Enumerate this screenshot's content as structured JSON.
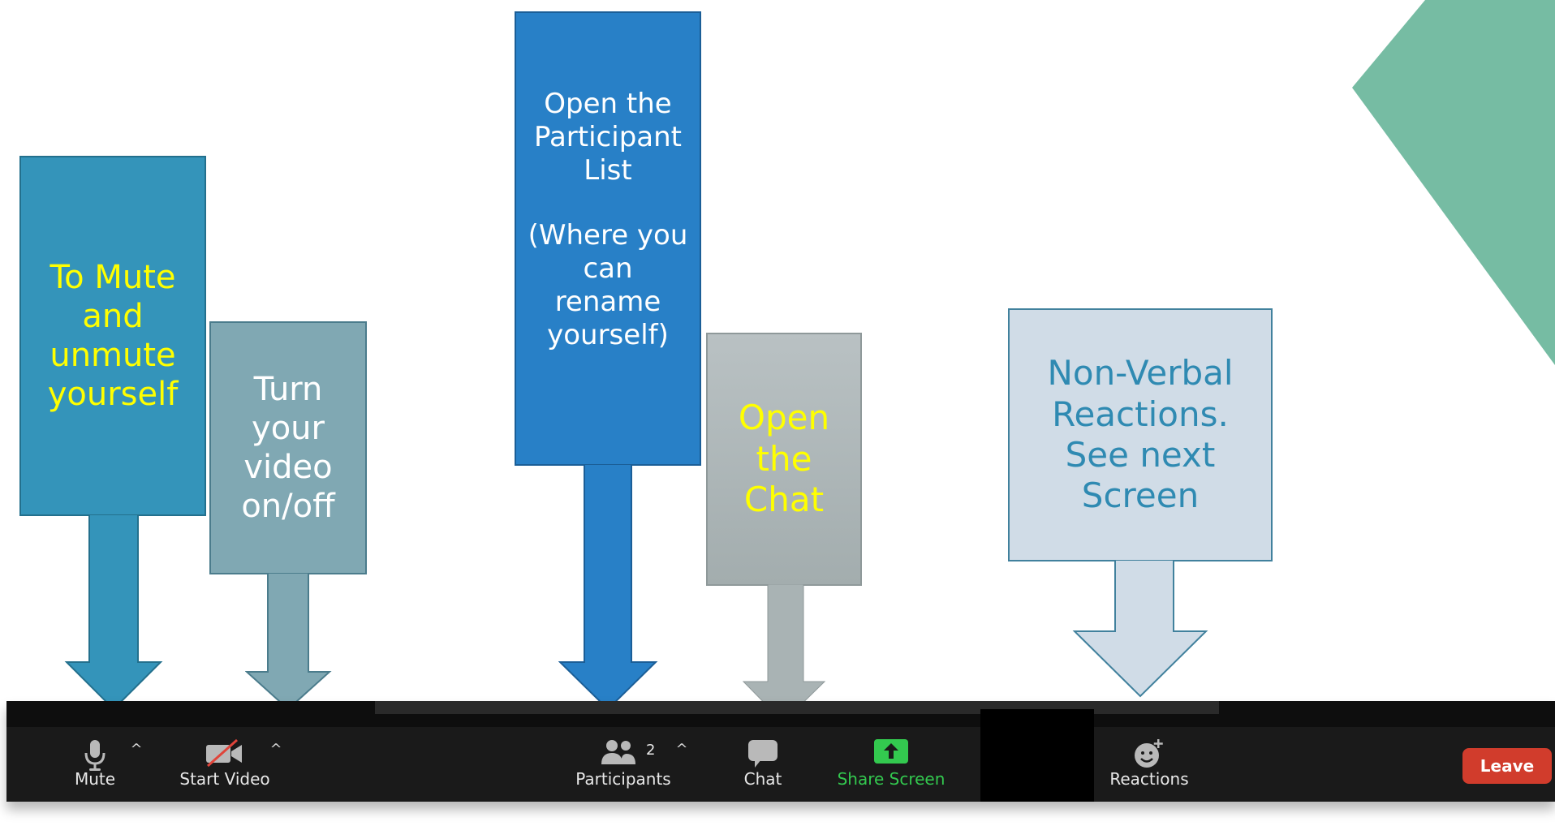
{
  "colors": {
    "accent_green": "#76bca3",
    "mute_callout": "#3494ba",
    "video_callout": "#80a8b3",
    "participants_callout": "#2880c7",
    "chat_callout": "#a9b3b4",
    "reactions_callout": "#d0dce7",
    "toolbar_bg": "#1a1a1a",
    "share_green": "#33c94f",
    "leave_red": "#d13c2c",
    "highlight_yellow": "#ffff00"
  },
  "callouts": {
    "mute": {
      "lines": [
        "To Mute",
        "and",
        "unmute",
        "yourself"
      ]
    },
    "video": {
      "lines": [
        "Turn",
        "your",
        "video",
        "on/off"
      ]
    },
    "participants": {
      "lines": [
        "Open the",
        "Participant",
        "List",
        "",
        "(Where you",
        "can",
        "rename",
        "yourself)"
      ]
    },
    "chat": {
      "lines": [
        "Open",
        "the",
        "Chat"
      ]
    },
    "reactions": {
      "lines": [
        "Non-Verbal",
        "Reactions.",
        "See next",
        "Screen"
      ]
    }
  },
  "toolbar": {
    "mute": {
      "label": "Mute",
      "icon": "microphone-icon"
    },
    "video": {
      "label": "Start Video",
      "icon": "video-off-icon"
    },
    "participants": {
      "label": "Participants",
      "count": "2",
      "icon": "participants-icon"
    },
    "chat": {
      "label": "Chat",
      "icon": "chat-bubble-icon"
    },
    "share": {
      "label": "Share Screen",
      "icon": "share-screen-icon"
    },
    "reactions": {
      "label": "Reactions",
      "icon": "add-reaction-icon"
    },
    "leave": {
      "label": "Leave"
    },
    "caret_icon": "chevron-up-icon"
  }
}
